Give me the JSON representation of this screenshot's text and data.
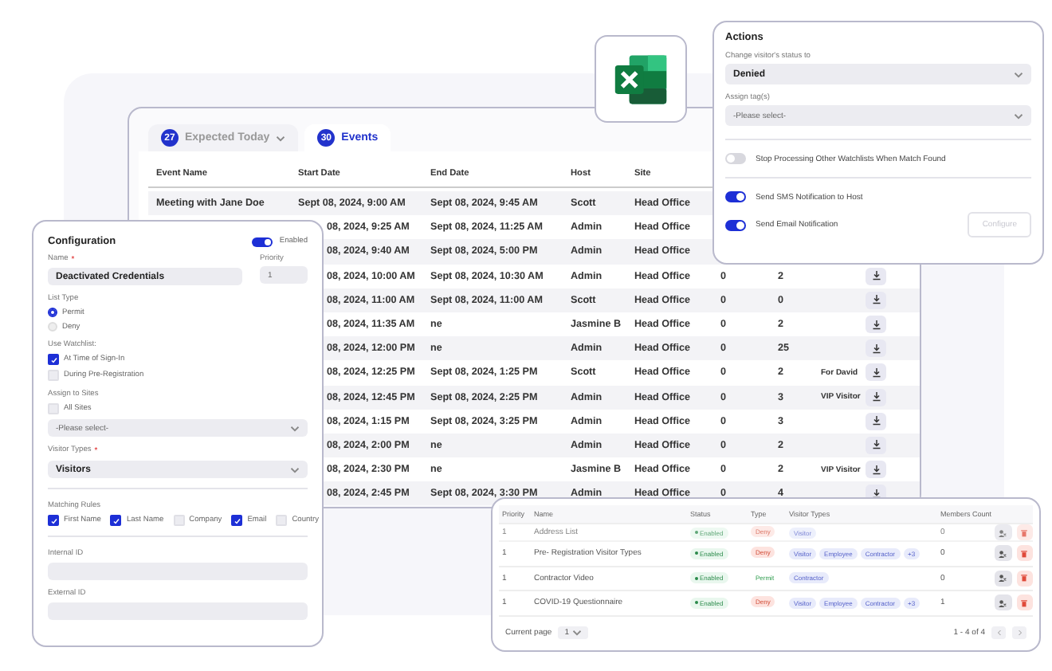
{
  "events_window": {
    "tabs": [
      {
        "count": "27",
        "label": "Expected Today",
        "caret": true,
        "selected": false
      },
      {
        "count": "30",
        "label": "Events",
        "selected": true
      }
    ],
    "columns": [
      "Event Name",
      "Start Date",
      "End Date",
      "Host",
      "Site"
    ],
    "rows": [
      {
        "event": "Meeting with Jane Doe",
        "start": "Sept 08, 2024, 9:00 AM",
        "end": "Sept 08, 2024, 9:45 AM",
        "host": "Scott",
        "site": "Head Office"
      },
      {
        "start": "08, 2024, 9:25 AM",
        "end": "Sept 08, 2024, 11:25 AM",
        "host": "Admin",
        "site": "Head Office"
      },
      {
        "start": "08, 2024, 9:40 AM",
        "end": "Sept 08, 2024, 5:00 PM",
        "host": "Admin",
        "site": "Head Office"
      },
      {
        "start": "08, 2024, 10:00 AM",
        "end": "Sept 08, 2024, 10:30 AM",
        "host": "Admin",
        "site": "Head Office",
        "col_6": "0",
        "col_7": "2"
      },
      {
        "start": "08, 2024, 11:00 AM",
        "end": "Sept 08, 2024, 11:00 AM",
        "host": "Scott",
        "site": "Head Office",
        "col_6": "0",
        "col_7": "0"
      },
      {
        "start": "08, 2024, 11:35 AM",
        "end": "ne",
        "host": "Jasmine B",
        "site": "Head Office",
        "col_6": "0",
        "col_7": "2"
      },
      {
        "start": "08, 2024, 12:00 PM",
        "end": "ne",
        "host": "Admin",
        "site": "Head Office",
        "col_6": "0",
        "col_7": "25"
      },
      {
        "start": "08, 2024, 12:25 PM",
        "end": "Sept 08, 2024, 1:25 PM",
        "host": "Scott",
        "site": "Head Office",
        "col_6": "0",
        "col_7": "2",
        "col_8": "For David"
      },
      {
        "start": "08, 2024, 12:45 PM",
        "end": "Sept 08, 2024, 2:25 PM",
        "host": "Admin",
        "site": "Head Office",
        "col_6": "0",
        "col_7": "3",
        "col_8": "VIP Visitor"
      },
      {
        "start": "08, 2024, 1:15 PM",
        "end": "Sept 08, 2024, 3:25 PM",
        "host": "Admin",
        "site": "Head Office",
        "col_6": "0",
        "col_7": "3"
      },
      {
        "start": "08, 2024, 2:00 PM",
        "end": "ne",
        "host": "Admin",
        "site": "Head Office",
        "col_6": "0",
        "col_7": "2"
      },
      {
        "start": "08, 2024, 2:30 PM",
        "end": "ne",
        "host": "Jasmine B",
        "site": "Head Office",
        "col_6": "0",
        "col_7": "2",
        "col_8": "VIP Visitor"
      },
      {
        "start": "08, 2024, 2:45 PM",
        "end": "Sept 08, 2024, 3:30 PM",
        "host": "Admin",
        "site": "Head Office",
        "col_6": "0",
        "col_7": "4"
      }
    ]
  },
  "configuration": {
    "title": "Configuration",
    "enabled": {
      "label": "Enabled",
      "on": true
    },
    "name": {
      "label": "Name",
      "required_mark": "*",
      "value": "Deactivated Credentials"
    },
    "priority": {
      "label": "Priority",
      "value": "1"
    },
    "list_type": {
      "label": "List Type",
      "options": [
        {
          "label": "Permit",
          "selected": true
        },
        {
          "label": "Deny",
          "selected": false
        }
      ]
    },
    "use_watchlist": {
      "label": "Use Watchlist:",
      "options": [
        {
          "label": "At Time of Sign-In",
          "checked": true
        },
        {
          "label": "During Pre-Registration",
          "checked": false
        }
      ]
    },
    "assign_sites": {
      "label": "Assign to Sites",
      "all_sites": {
        "label": "All Sites",
        "checked": false
      },
      "select": "-Please select-"
    },
    "visitor_types": {
      "label": "Visitor Types",
      "required_mark": "*",
      "value": "Visitors"
    },
    "matching_rules": {
      "label": "Matching Rules",
      "options": [
        {
          "label": "First Name",
          "checked": true
        },
        {
          "label": "Last Name",
          "checked": true
        },
        {
          "label": "Company",
          "checked": false
        },
        {
          "label": "Email",
          "checked": true
        },
        {
          "label": "Country",
          "checked": false
        }
      ]
    },
    "internal_id": {
      "label": "Internal ID"
    },
    "external_id": {
      "label": "External ID"
    }
  },
  "actions": {
    "title": "Actions",
    "status": {
      "label": "Change visitor's status to",
      "value": "Denied"
    },
    "tags": {
      "label": "Assign tag(s)",
      "value": "-Please select-"
    },
    "stop_processing": {
      "label": "Stop Processing Other Watchlists When Match Found",
      "on": false
    },
    "sms": {
      "label": "Send SMS Notification to Host",
      "on": true
    },
    "email": {
      "label": "Send Email Notification",
      "on": true
    },
    "configure": {
      "label": "Configure",
      "disabled": true
    }
  },
  "watchlists": {
    "columns": [
      "Priority",
      "Name",
      "Status",
      "Type",
      "Visitor Types",
      "Members Count"
    ],
    "rows": [
      {
        "priority": "1",
        "name": "Address List",
        "status": "Enabled",
        "type": {
          "label": "Deny",
          "kind": "deny"
        },
        "visitor_types": [
          "Visitor"
        ],
        "members": "0",
        "faded": true
      },
      {
        "priority": "1",
        "name": "Pre- Registration Visitor Types",
        "status": "Enabled",
        "type": {
          "label": "Deny",
          "kind": "deny"
        },
        "visitor_types": [
          "Visitor",
          "Employee",
          "Contractor",
          "+3"
        ],
        "members": "0",
        "faded": false
      },
      {
        "priority": "1",
        "name": "Contractor Video",
        "status": "Enabled",
        "type": {
          "label": "Permit",
          "kind": "permit"
        },
        "visitor_types": [
          "Contractor"
        ],
        "members": "0",
        "faded": false
      },
      {
        "priority": "1",
        "name": "COVID-19 Questionnaire",
        "status": "Enabled",
        "type": {
          "label": "Deny",
          "kind": "deny"
        },
        "visitor_types": [
          "Visitor",
          "Employee",
          "Contractor",
          "+3"
        ],
        "members": "1",
        "faded": false
      }
    ],
    "pager": {
      "label": "Current page",
      "page": "1",
      "range": "1 - 4 of 4"
    }
  }
}
